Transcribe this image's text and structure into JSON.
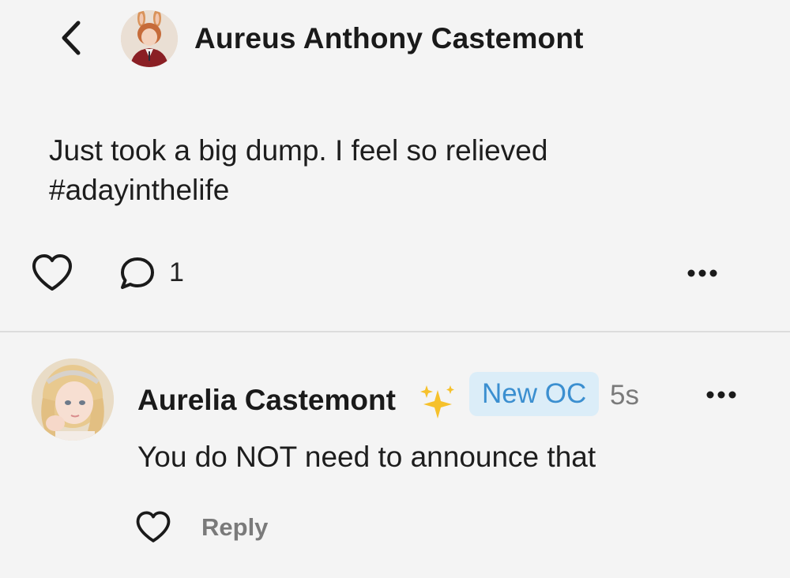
{
  "post": {
    "author_name": "Aureus Anthony Castemont",
    "text_line1": "Just took a big dump. I feel so relieved",
    "text_line2": "#adayinthelife",
    "comment_count": "1"
  },
  "comment": {
    "author_name": "Aurelia Castemont",
    "badge": "New OC",
    "timestamp": "5s",
    "text": "You do NOT need to announce that",
    "reply_label": "Reply"
  },
  "icons": {
    "back": "chevron-left-icon",
    "like": "heart-outline-icon",
    "comment": "speech-bubble-icon",
    "more": "more-horizontal-icon",
    "sparkle": "sparkles-emoji"
  },
  "colors": {
    "background": "#f4f4f4",
    "badge_bg": "#dbedf8",
    "badge_text": "#3b8fd0",
    "muted_text": "#7a7a7a",
    "sparkle": "#f6c12b"
  }
}
